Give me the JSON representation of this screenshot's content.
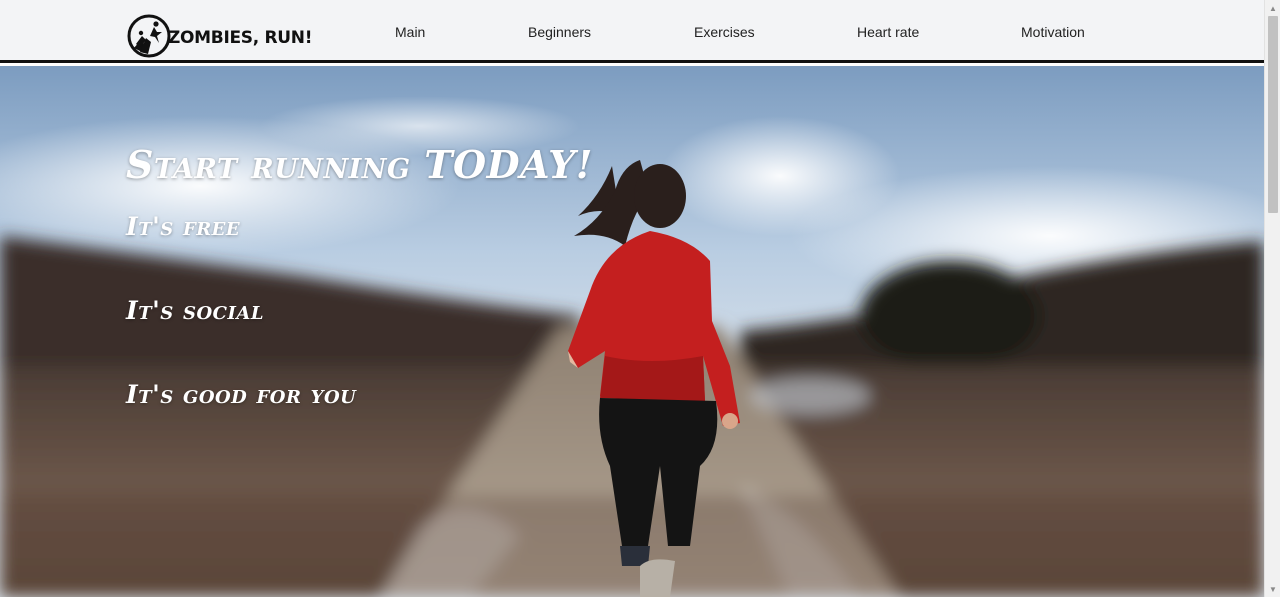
{
  "brand": {
    "name": "ZOMBIES, RUN!"
  },
  "nav": {
    "items": [
      {
        "label": "Main"
      },
      {
        "label": "Beginners"
      },
      {
        "label": "Exercises"
      },
      {
        "label": "Heart rate"
      },
      {
        "label": "Motivation"
      }
    ]
  },
  "hero": {
    "title": "Start running TODAY!",
    "lines": [
      "It's free",
      "It's social",
      "It's good for you"
    ],
    "image_icon": "woman-running-photo"
  },
  "colors": {
    "header_bg": "#f3f4f6",
    "header_border": "#111111",
    "hero_text": "#ffffff",
    "jacket_red": "#c41f1f"
  }
}
